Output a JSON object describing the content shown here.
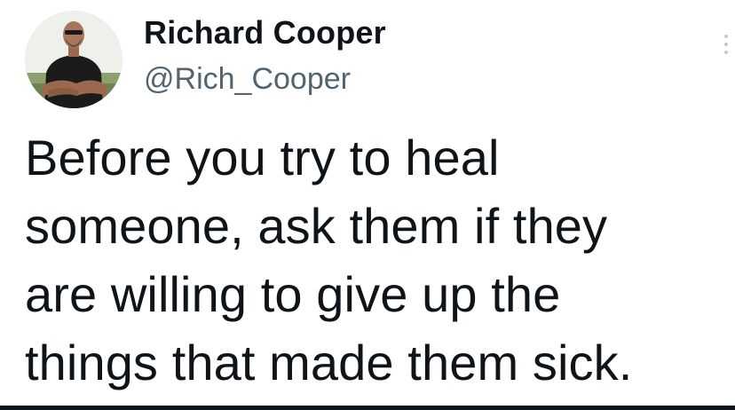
{
  "tweet": {
    "author": {
      "display_name": "Richard Cooper",
      "handle": "@Rich_Cooper",
      "avatar_icon": "profile-photo"
    },
    "text": "Before you try to heal\nsomeone, ask them if they\nare willing to give up the\nthings that made them sick.",
    "more_icon": "vertical-ellipsis-icon"
  },
  "colors": {
    "text_primary": "#0f1419",
    "text_secondary": "#536471",
    "background": "#ffffff"
  }
}
